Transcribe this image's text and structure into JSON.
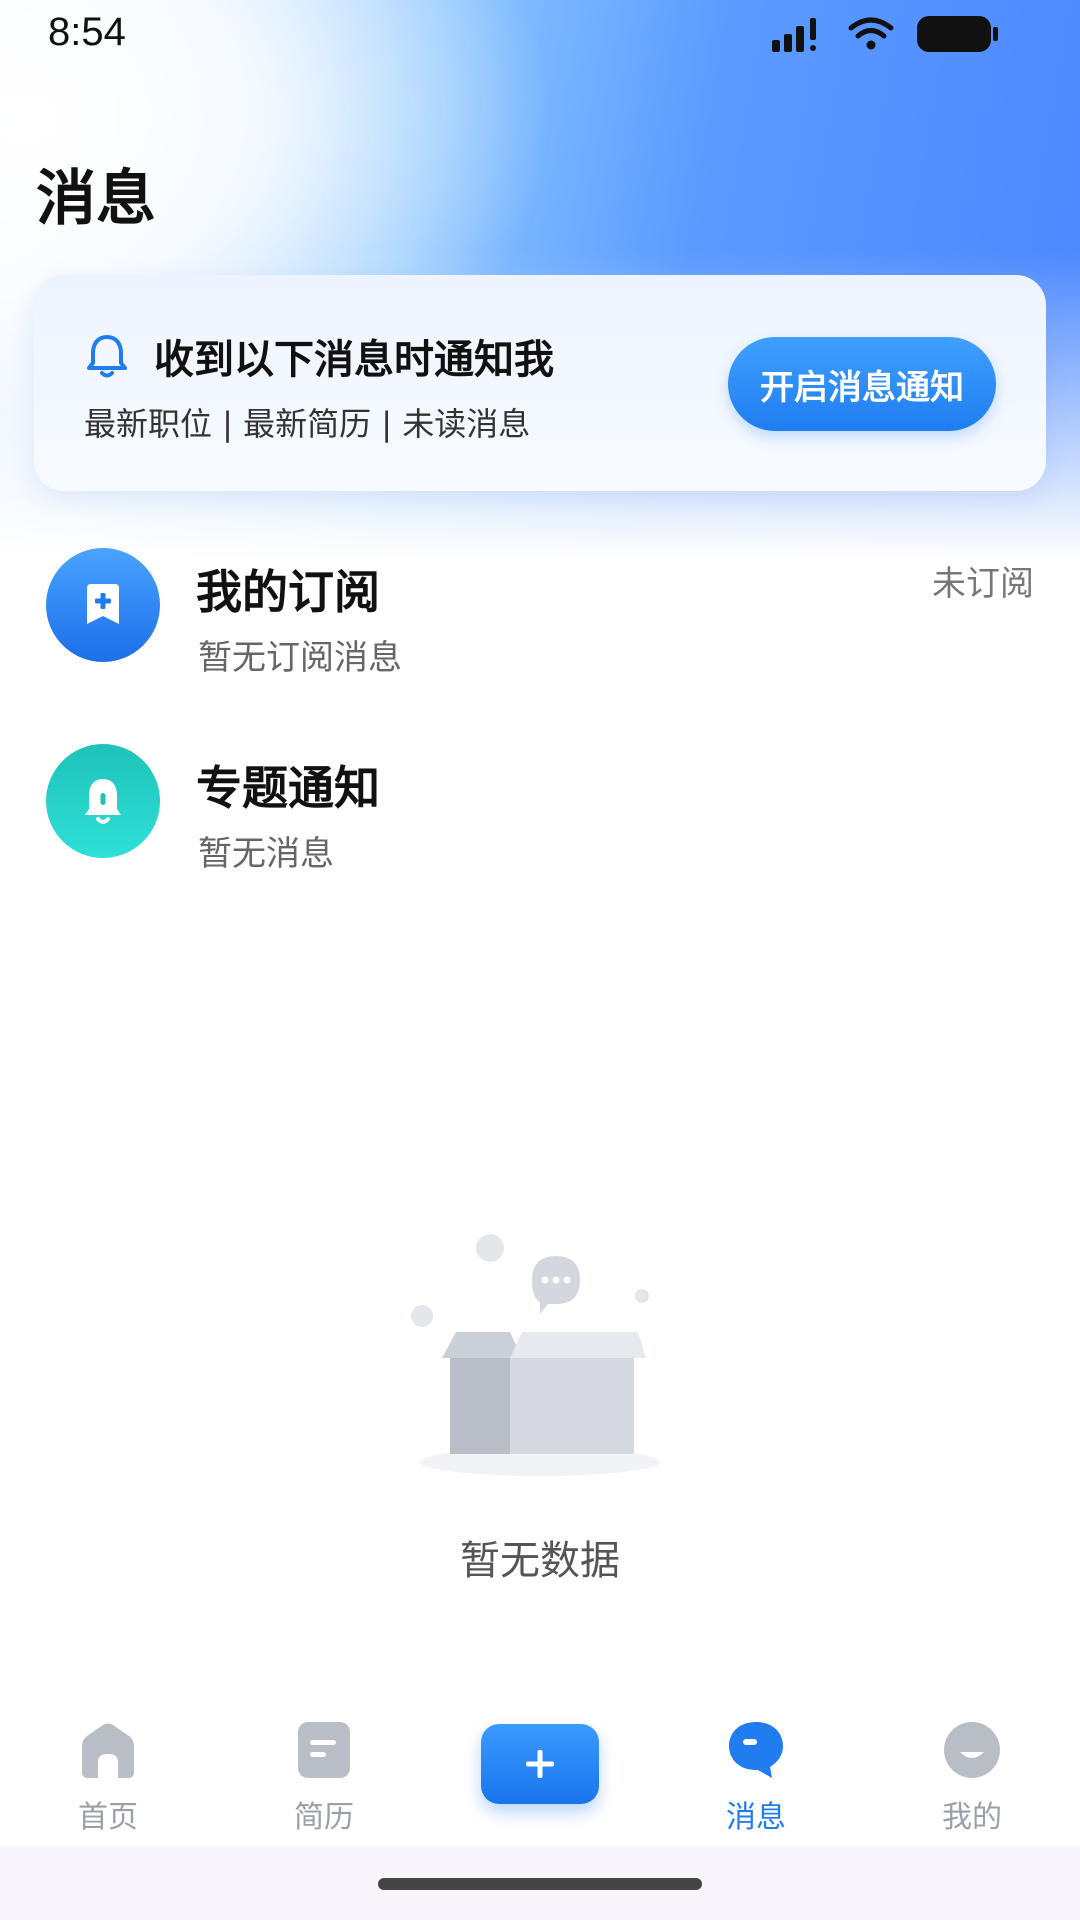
{
  "status_bar": {
    "time": "8:54"
  },
  "page": {
    "title": "消息"
  },
  "notify_card": {
    "title": "收到以下消息时通知我",
    "subtitle": "最新职位 | 最新简历 | 未读消息",
    "button_label": "开启消息通知"
  },
  "messages": [
    {
      "title": "我的订阅",
      "subtitle": "暂无订阅消息",
      "status": "未订阅",
      "icon": "bookmark-plus-icon"
    },
    {
      "title": "专题通知",
      "subtitle": "暂无消息",
      "status": "",
      "icon": "bell-icon"
    }
  ],
  "empty_state": {
    "text": "暂无数据"
  },
  "tabbar": {
    "items": [
      {
        "label": "首页",
        "icon": "home-icon",
        "active": false
      },
      {
        "label": "简历",
        "icon": "resume-icon",
        "active": false
      },
      {
        "label": "",
        "icon": "plus-icon",
        "active": false
      },
      {
        "label": "消息",
        "icon": "message-icon",
        "active": true
      },
      {
        "label": "我的",
        "icon": "profile-icon",
        "active": false
      }
    ]
  },
  "colors": {
    "accent": "#1f7df0",
    "teal": "#1fc2b8",
    "inactive": "#9aa0a8"
  }
}
